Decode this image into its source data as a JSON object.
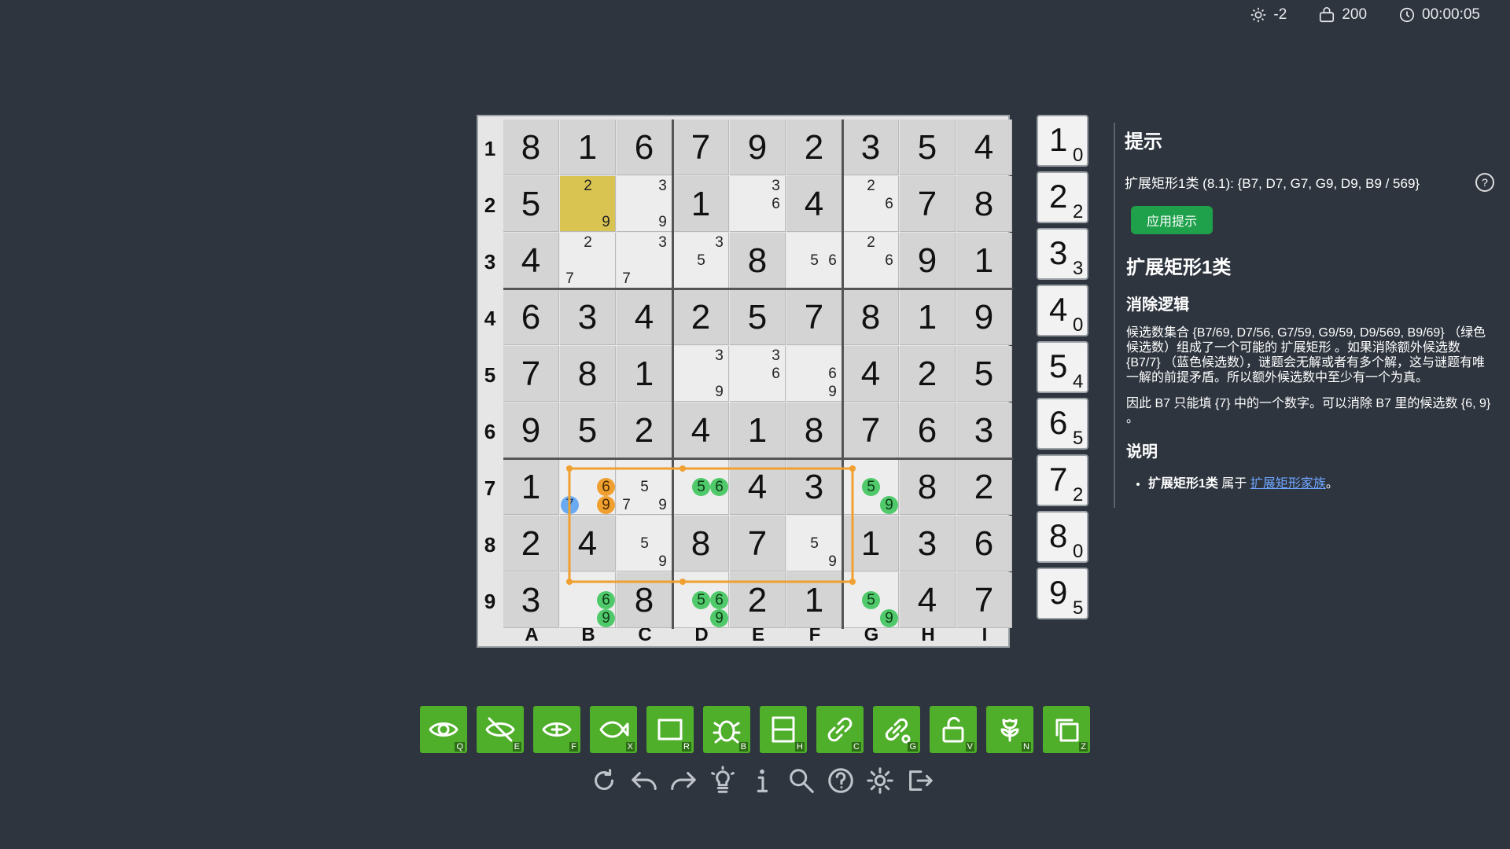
{
  "status": {
    "brightness": "-2",
    "score": "200",
    "time": "00:00:05"
  },
  "board": {
    "row_labels": [
      "1",
      "2",
      "3",
      "4",
      "5",
      "6",
      "7",
      "8",
      "9"
    ],
    "col_labels": [
      "A",
      "B",
      "C",
      "D",
      "E",
      "F",
      "G",
      "H",
      "I"
    ],
    "rows": [
      [
        "8",
        "1",
        "6",
        "7",
        "9",
        "2",
        "3",
        "5",
        "4"
      ],
      [
        "5",
        "",
        "",
        "1",
        "",
        "4",
        "",
        "7",
        "8"
      ],
      [
        "4",
        "",
        "",
        "",
        "8",
        "",
        "",
        "9",
        "1"
      ],
      [
        "6",
        "3",
        "4",
        "2",
        "5",
        "7",
        "8",
        "1",
        "9"
      ],
      [
        "7",
        "8",
        "1",
        "",
        "",
        "",
        "4",
        "2",
        "5"
      ],
      [
        "9",
        "5",
        "2",
        "4",
        "1",
        "8",
        "7",
        "6",
        "3"
      ],
      [
        "1",
        "",
        "",
        "",
        "4",
        "3",
        "",
        "8",
        "2"
      ],
      [
        "2",
        "4",
        "",
        "8",
        "7",
        "",
        "1",
        "3",
        "6"
      ],
      [
        "3",
        "",
        "8",
        "",
        "2",
        "1",
        "",
        "4",
        "7"
      ]
    ],
    "highlight_cell": "B2",
    "candidates": {
      "B2": [
        {
          "d": "2"
        },
        {
          "d": "9"
        }
      ],
      "C2": [
        {
          "d": "3"
        },
        {
          "d": "9"
        }
      ],
      "E2": [
        {
          "d": "3"
        },
        {
          "d": "6"
        }
      ],
      "G2": [
        {
          "d": "2"
        },
        {
          "d": "6"
        }
      ],
      "B3": [
        {
          "d": "2"
        },
        {
          "d": "7"
        }
      ],
      "C3": [
        {
          "d": "3"
        },
        {
          "d": "7"
        }
      ],
      "D3": [
        {
          "d": "3"
        },
        {
          "d": "5"
        }
      ],
      "F3": [
        {
          "d": "5"
        },
        {
          "d": "6"
        }
      ],
      "G3": [
        {
          "d": "2"
        },
        {
          "d": "6"
        }
      ],
      "D5": [
        {
          "d": "3"
        },
        {
          "d": "9"
        }
      ],
      "E5": [
        {
          "d": "3"
        },
        {
          "d": "6"
        }
      ],
      "F5": [
        {
          "d": "6"
        },
        {
          "d": "9"
        }
      ],
      "B7": [
        {
          "d": "6",
          "color": "orange"
        },
        {
          "d": "7",
          "color": "blue"
        },
        {
          "d": "9",
          "color": "orange"
        }
      ],
      "C7": [
        {
          "d": "5"
        },
        {
          "d": "7"
        },
        {
          "d": "9"
        }
      ],
      "D7": [
        {
          "d": "5",
          "color": "green"
        },
        {
          "d": "6",
          "color": "green"
        }
      ],
      "G7": [
        {
          "d": "5",
          "color": "green"
        },
        {
          "d": "9",
          "color": "green"
        }
      ],
      "C8": [
        {
          "d": "5"
        },
        {
          "d": "9"
        }
      ],
      "F8": [
        {
          "d": "5"
        },
        {
          "d": "9"
        }
      ],
      "B9": [
        {
          "d": "6",
          "color": "green"
        },
        {
          "d": "9",
          "color": "green"
        }
      ],
      "D9": [
        {
          "d": "5",
          "color": "green"
        },
        {
          "d": "6",
          "color": "green"
        },
        {
          "d": "9",
          "color": "green"
        }
      ],
      "G9": [
        {
          "d": "5",
          "color": "green"
        },
        {
          "d": "9",
          "color": "green"
        }
      ]
    },
    "rectangle_color": "#f0a030"
  },
  "counters": [
    {
      "digit": "1",
      "count": "0"
    },
    {
      "digit": "2",
      "count": "2"
    },
    {
      "digit": "3",
      "count": "3"
    },
    {
      "digit": "4",
      "count": "0"
    },
    {
      "digit": "5",
      "count": "4"
    },
    {
      "digit": "6",
      "count": "5"
    },
    {
      "digit": "7",
      "count": "2"
    },
    {
      "digit": "8",
      "count": "0"
    },
    {
      "digit": "9",
      "count": "5"
    }
  ],
  "hint": {
    "title": "提示",
    "summary": "扩展矩形1类 (8.1): {B7, D7, G7, G9, D9, B9 / 569}",
    "apply_label": "应用提示",
    "technique_title": "扩展矩形1类",
    "logic_heading": "消除逻辑",
    "logic_text": "候选数集合 {B7/69, D7/56, G7/59, G9/59, D9/569, B9/69} （绿色候选数）组成了一个可能的 扩展矩形 。如果消除额外候选数 {B7/7} （蓝色候选数），谜题会无解或者有多个解，这与谜题有唯一解的前提矛盾。所以额外候选数中至少有一个为真。",
    "conclusion_text": "因此 B7 只能填 {7} 中的一个数字。可以消除 B7 里的候选数 {6, 9} 。",
    "notes_heading": "说明",
    "note_bold": "扩展矩形1类",
    "note_mid": "属于",
    "note_link": "扩展矩形家族",
    "note_end": "。"
  },
  "tools": [
    {
      "icon": "eye-icon",
      "key": "Q"
    },
    {
      "icon": "eye-off-icon",
      "key": "E"
    },
    {
      "icon": "eye-filter-icon",
      "key": "F"
    },
    {
      "icon": "fish-icon",
      "key": "X"
    },
    {
      "icon": "rectangle-icon",
      "key": "R"
    },
    {
      "icon": "bug-icon",
      "key": "B"
    },
    {
      "icon": "house-split-icon",
      "key": "H"
    },
    {
      "icon": "chain-icon",
      "key": "C"
    },
    {
      "icon": "chain-group-icon",
      "key": "G"
    },
    {
      "icon": "unlock-icon",
      "key": "V"
    },
    {
      "icon": "flower-icon",
      "key": "N"
    },
    {
      "icon": "copy-icon",
      "key": "Z"
    }
  ],
  "actions": [
    {
      "icon": "restart-icon"
    },
    {
      "icon": "undo-icon"
    },
    {
      "icon": "redo-icon"
    },
    {
      "icon": "lightbulb-icon"
    },
    {
      "icon": "info-icon"
    },
    {
      "icon": "search-icon"
    },
    {
      "icon": "help-icon"
    },
    {
      "icon": "settings-icon"
    },
    {
      "icon": "exit-icon"
    }
  ]
}
